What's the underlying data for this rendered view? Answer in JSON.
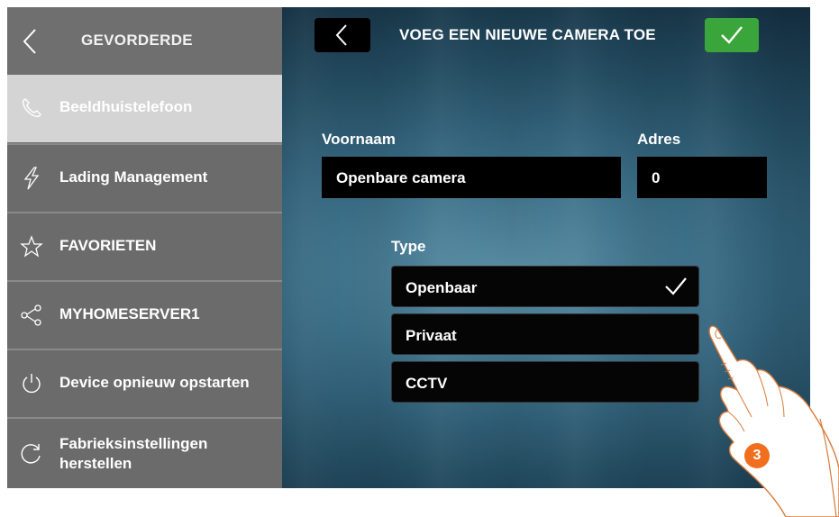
{
  "sidebar": {
    "header_title": "GEVORDERDE",
    "items": [
      {
        "label": "Beeldhuistelefoon",
        "icon": "phone-icon",
        "active": true
      },
      {
        "label": "Lading Management",
        "icon": "lightning-icon",
        "active": false
      },
      {
        "label": "FAVORIETEN",
        "icon": "star-icon",
        "active": false
      },
      {
        "label": "MYHOMESERVER1",
        "icon": "share-icon",
        "active": false
      },
      {
        "label": "Device opnieuw opstarten",
        "icon": "power-icon",
        "active": false
      },
      {
        "label": "Fabrieksinstellingen herstellen",
        "icon": "reset-icon",
        "active": false
      }
    ]
  },
  "header": {
    "title": "VOEG EEN NIEUWE CAMERA TOE",
    "back_icon": "chevron-left-icon",
    "confirm_icon": "checkmark-icon"
  },
  "form": {
    "name_label": "Voornaam",
    "name_value": "Openbare camera",
    "address_label": "Adres",
    "address_value": "0",
    "type_label": "Type",
    "type_options": [
      {
        "label": "Openbaar",
        "selected": true
      },
      {
        "label": "Privaat",
        "selected": false
      },
      {
        "label": "CCTV",
        "selected": false
      }
    ]
  },
  "annotation": {
    "step_number": "3"
  },
  "colors": {
    "confirm_green": "#3aa53a",
    "sidebar_gray": "#6b6b6b",
    "active_item": "#d4d4d4",
    "badge_orange": "#f06e1e"
  }
}
